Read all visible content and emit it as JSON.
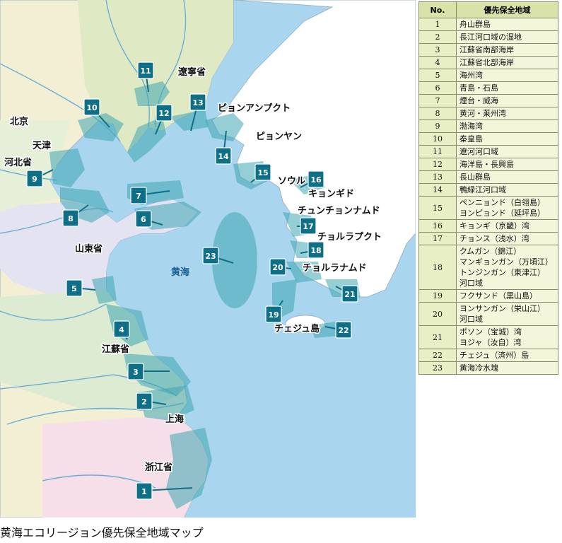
{
  "map": {
    "sea_label": "黄海",
    "place_labels": {
      "beijing": "北京",
      "tianjin": "天津",
      "hebei": "河北省",
      "liaoning": "遼寧省",
      "shandong": "山東省",
      "jiangsu": "江蘇省",
      "shanghai": "上海",
      "zhejiang": "浙江省",
      "pyongannamdo": "ピョンアンプクト",
      "pyongyang": "ピョンヤン",
      "seoul": "ソウル",
      "gyeonggido": "キョンギド",
      "chungcheongnamdo": "チュンチョンナムド",
      "jeollabukdo": "チョルラプクト",
      "jeollanamdo": "チョルラナムド",
      "jejudo": "チェジュ島"
    },
    "markers": [
      "1",
      "2",
      "3",
      "4",
      "5",
      "6",
      "7",
      "8",
      "9",
      "10",
      "11",
      "12",
      "13",
      "14",
      "15",
      "16",
      "17",
      "18",
      "19",
      "20",
      "21",
      "22",
      "23"
    ],
    "colors": {
      "sea": "#a9d6ee",
      "zone": "#3ea6b3",
      "marker": "#0f6f86",
      "china": "#f3efd4",
      "korea": "#ffffff"
    }
  },
  "legend": {
    "header_no": "No.",
    "header_area": "優先保全地域",
    "rows": [
      {
        "no": "1",
        "name": "舟山群島"
      },
      {
        "no": "2",
        "name": "長江河口域の湿地"
      },
      {
        "no": "3",
        "name": "江蘇省南部海岸"
      },
      {
        "no": "4",
        "name": "江蘇省北部海岸"
      },
      {
        "no": "5",
        "name": "海州湾"
      },
      {
        "no": "6",
        "name": "青島・石島"
      },
      {
        "no": "7",
        "name": "煙台・威海"
      },
      {
        "no": "8",
        "name": "黄河・莱州湾"
      },
      {
        "no": "9",
        "name": "渤海湾"
      },
      {
        "no": "10",
        "name": "秦皇島"
      },
      {
        "no": "11",
        "name": "遼河河口域"
      },
      {
        "no": "12",
        "name": "海洋島・長興島"
      },
      {
        "no": "13",
        "name": "長山群島"
      },
      {
        "no": "14",
        "name": "鴨緑江河口域"
      },
      {
        "no": "15",
        "name": "ペンニョンド（白翎島）\nヨンピョンド（延坪島）"
      },
      {
        "no": "16",
        "name": "キョンギ（京畿）湾"
      },
      {
        "no": "17",
        "name": "チョンス（浅水）湾"
      },
      {
        "no": "18",
        "name": "クムガン（錦江）\nマンギョンガン（万頃江）\nトンジンガン（東津江）\n河口域"
      },
      {
        "no": "19",
        "name": "フクサンド（黒山島）"
      },
      {
        "no": "20",
        "name": "ヨンサンガン（栄山江）\n河口域"
      },
      {
        "no": "21",
        "name": "ポソン（宝城）湾\nヨジャ（汝自）湾"
      },
      {
        "no": "22",
        "name": "チェジュ（済州）島"
      },
      {
        "no": "23",
        "name": "黄海冷水塊"
      }
    ]
  },
  "caption": "黄海エコリージョン優先保全地域マップ"
}
